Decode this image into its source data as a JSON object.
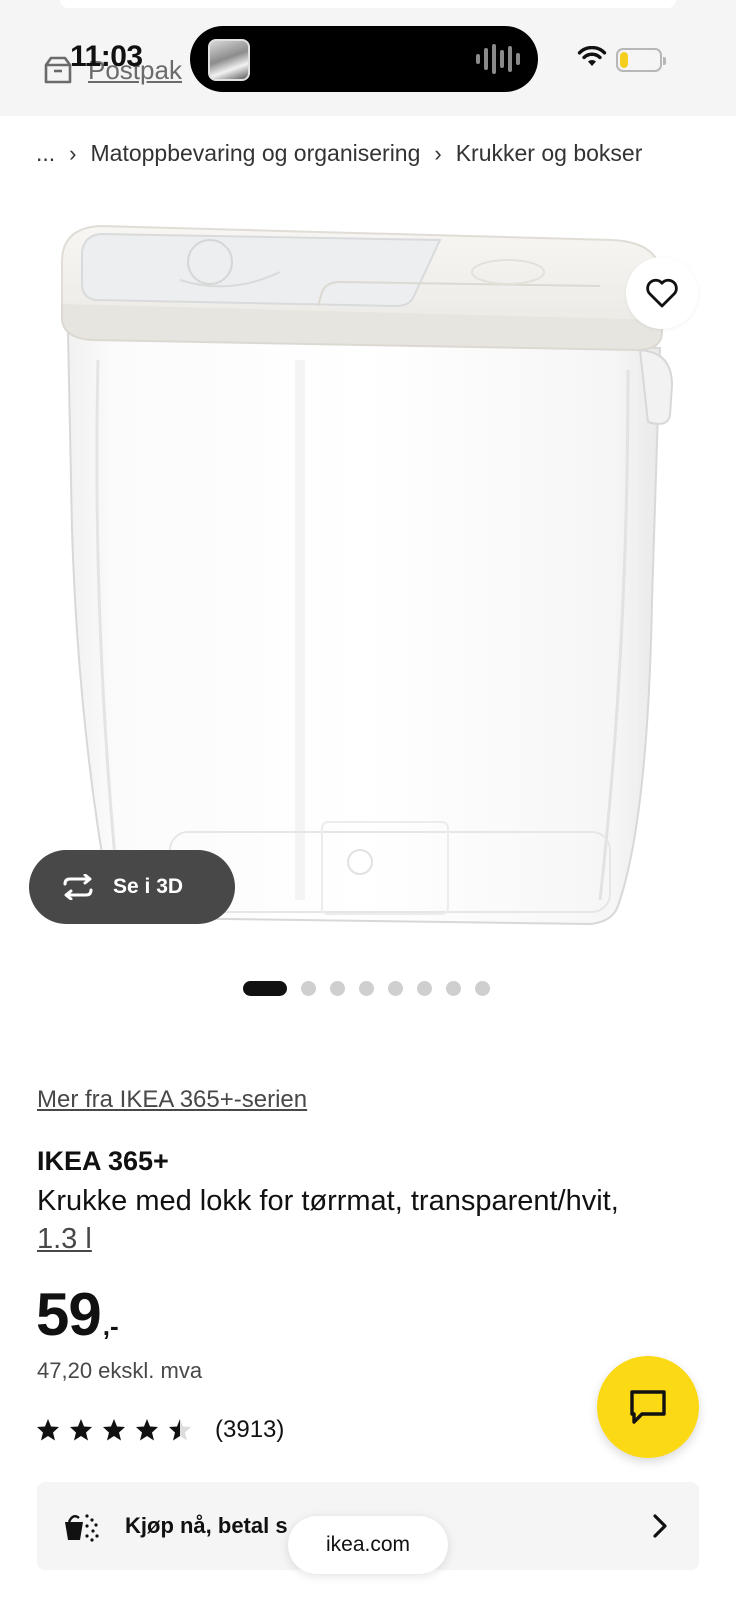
{
  "status_bar": {
    "time": "11:03",
    "battery_level": 0.2,
    "battery_color": "#f5cf1f",
    "icons": [
      "wifi-icon",
      "battery-icon"
    ]
  },
  "header": {
    "postpak_label": "Postpak",
    "icon": "parcel-box-icon"
  },
  "breadcrumb": {
    "items": [
      "...",
      "Matoppbevaring og organisering",
      "Krukker og bokser"
    ],
    "separator": "›"
  },
  "gallery": {
    "see_3d_label": "Se i 3D",
    "total_images": 8,
    "active_index": 0,
    "favorite_icon": "heart-icon"
  },
  "product": {
    "series_link": "Mer fra IKEA 365+-serien",
    "brand": "IKEA 365+",
    "description": "Krukke med lokk for tørrmat, transparent/hvit,",
    "size": "1.3 l",
    "price_main": "59",
    "price_suffix": ",-",
    "price_ex_vat": "47,20 ekskl. mva",
    "rating": 4.5,
    "rating_count": "(3913)"
  },
  "payment": {
    "label": "Kjøp nå, betal s",
    "icon": "shopping-bag-icon"
  },
  "browser": {
    "url": "ikea.com"
  },
  "colors": {
    "accent_yellow": "#fbd914",
    "text_dark": "#111111",
    "text_muted": "#484848"
  }
}
